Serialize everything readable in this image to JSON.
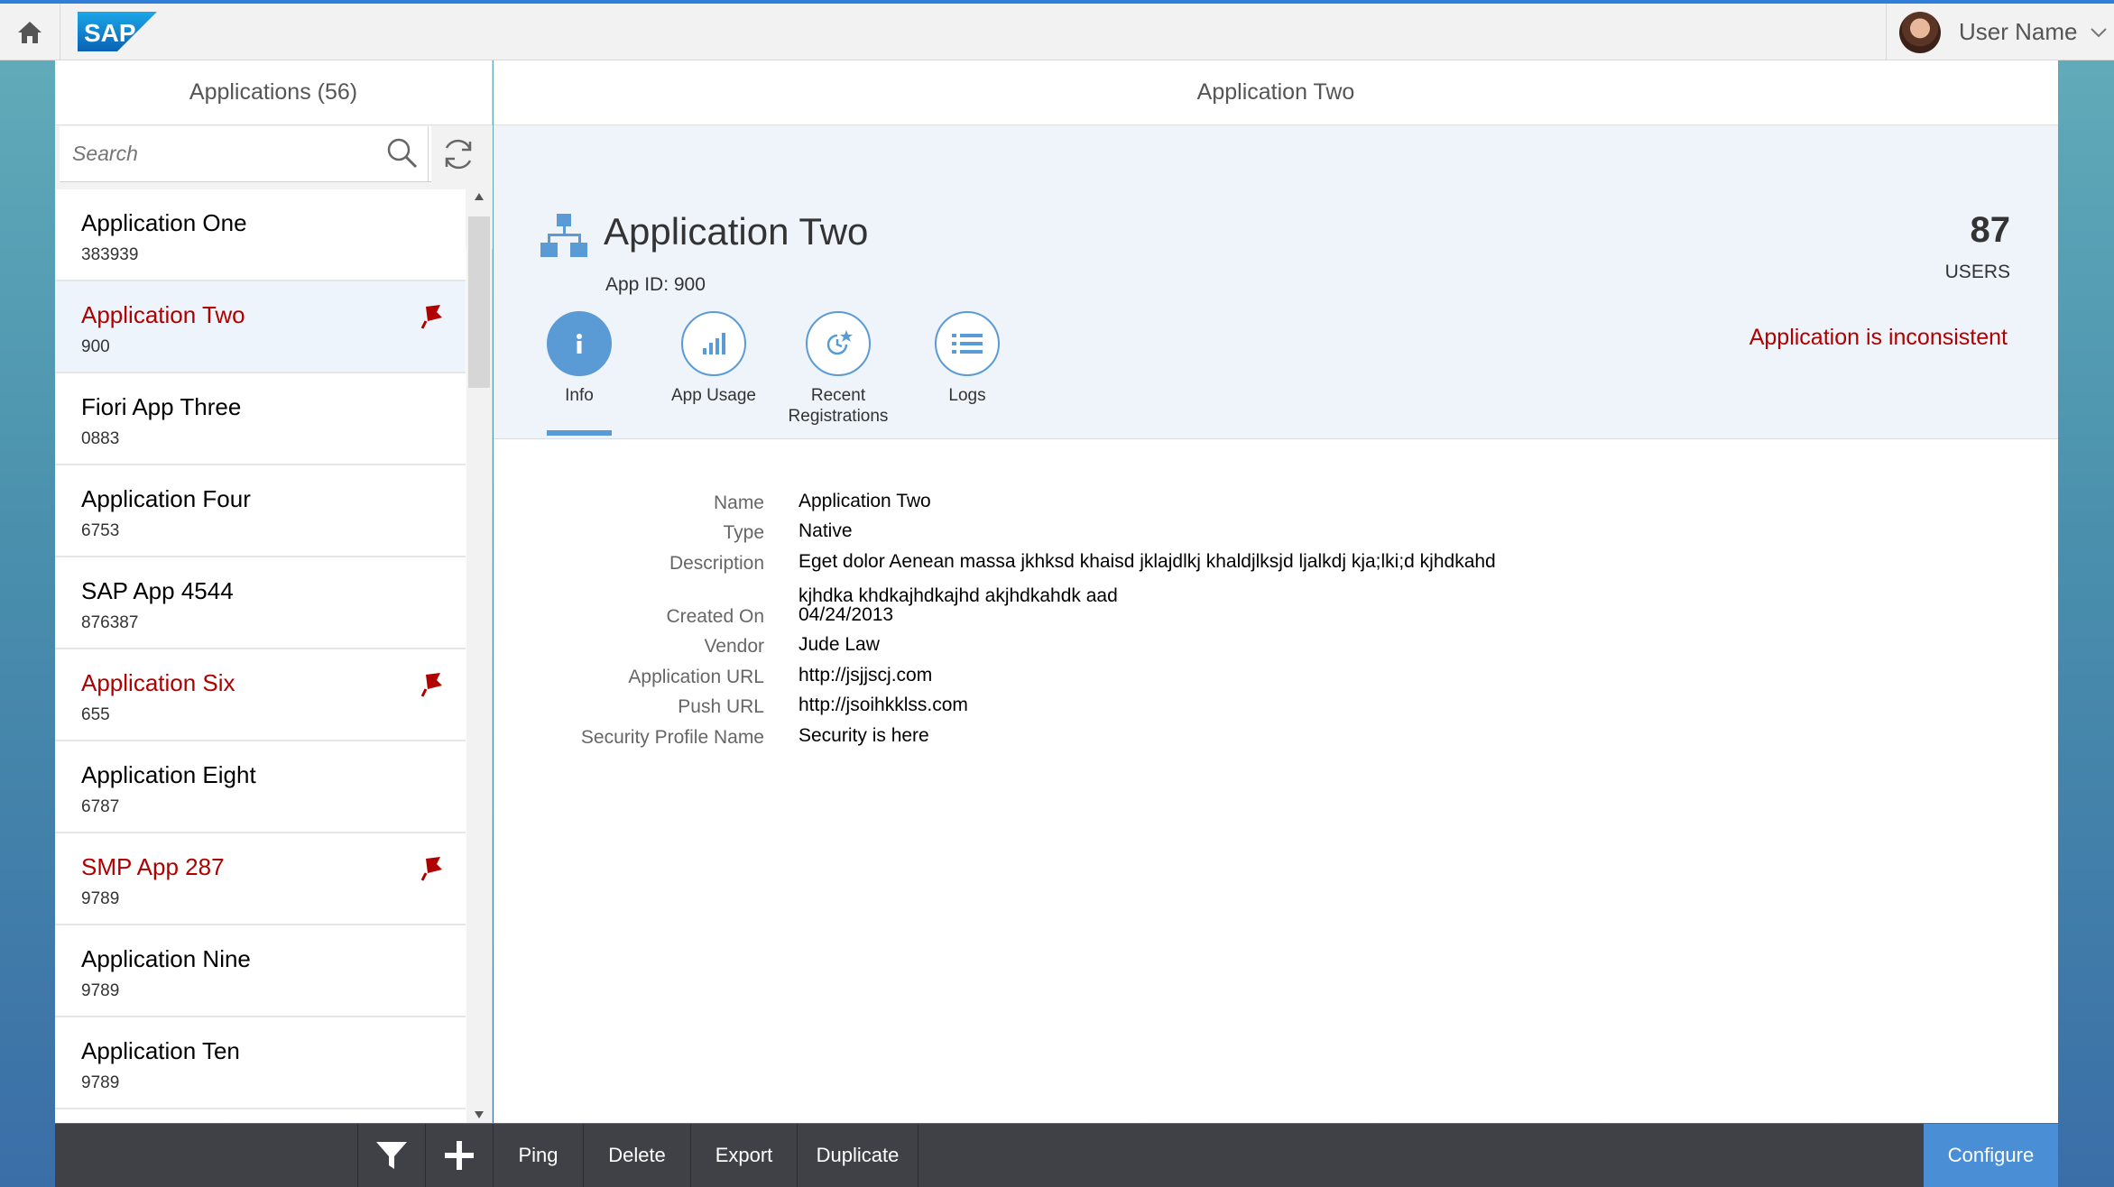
{
  "shell": {
    "logo_text": "SAP",
    "user_name": "User Name"
  },
  "master": {
    "header": "Applications (56)",
    "search_placeholder": "Search",
    "items": [
      {
        "title": "Application One",
        "sub": "383939",
        "flagged": false,
        "selected": false
      },
      {
        "title": "Application Two",
        "sub": "900",
        "flagged": true,
        "selected": true
      },
      {
        "title": "Fiori App Three",
        "sub": "0883",
        "flagged": false,
        "selected": false
      },
      {
        "title": "Application Four",
        "sub": "6753",
        "flagged": false,
        "selected": false
      },
      {
        "title": "SAP App 4544",
        "sub": "876387",
        "flagged": false,
        "selected": false
      },
      {
        "title": "Application Six",
        "sub": "655",
        "flagged": true,
        "selected": false
      },
      {
        "title": "Application Eight",
        "sub": "6787",
        "flagged": false,
        "selected": false
      },
      {
        "title": "SMP App 287",
        "sub": "9789",
        "flagged": true,
        "selected": false
      },
      {
        "title": "Application Nine",
        "sub": "9789",
        "flagged": false,
        "selected": false
      },
      {
        "title": "Application Ten",
        "sub": "9789",
        "flagged": false,
        "selected": false
      }
    ]
  },
  "detail": {
    "header": "Application Two",
    "object": {
      "title": "Application Two",
      "id_text": "App ID: 900",
      "number": "87",
      "unit": "USERS",
      "status": "Application is inconsistent"
    },
    "tabs": [
      {
        "label": "Info",
        "icon": "info-icon",
        "active": true
      },
      {
        "label": "App Usage",
        "icon": "bar-chart-icon",
        "active": false
      },
      {
        "label": "Recent Registrations",
        "icon": "registrations-icon",
        "active": false
      },
      {
        "label": "Logs",
        "icon": "list-icon",
        "active": false
      }
    ],
    "fields": [
      {
        "label": "Name",
        "value": "Application Two"
      },
      {
        "label": "Type",
        "value": "Native"
      },
      {
        "label": "Description",
        "value": "Eget dolor Aenean massa  jkhksd  khaisd jklajdlkj  khaldjlksjd   ljalkdj  kja;lki;d   kjhdkahd kjhdka  khdkajhdkajhd   akjhdkahdk  aad"
      },
      {
        "label": "Created On",
        "value": "04/24/2013"
      },
      {
        "label": "Vendor",
        "value": "Jude Law"
      },
      {
        "label": "Application URL",
        "value": "http://jsjjscj.com"
      },
      {
        "label": "Push URL",
        "value": "http://jsoihkklss.com"
      },
      {
        "label": "Security Profile Name",
        "value": "Security is here"
      }
    ]
  },
  "footer": {
    "ping": "Ping",
    "delete": "Delete",
    "export": "Export",
    "duplicate": "Duplicate",
    "configure": "Configure"
  },
  "colors": {
    "accent": "#5b9bd5",
    "error": "#b00000",
    "footer_bg": "#3f4146",
    "configure_bg": "#4a8fd6"
  }
}
